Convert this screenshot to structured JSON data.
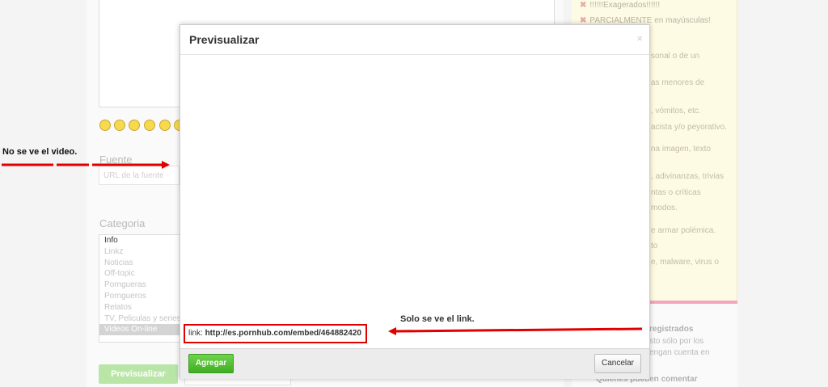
{
  "modal": {
    "title": "Previsualizar",
    "close_glyph": "×",
    "link_prefix": "link: ",
    "link_url": "http://es.pornhub.com/embed/464882420",
    "agregar_label": "Agregar",
    "cancelar_label": "Cancelar"
  },
  "form": {
    "fuente_label": "Fuente",
    "fuente_placeholder": "URL de la fuente",
    "categoria_label": "Categoria",
    "categories": [
      "Info",
      "Linkz",
      "Noticias",
      "Off-topic",
      "Porngueras",
      "Porngueros",
      "Relatos",
      "TV, Peliculas y series",
      "Videos On-line"
    ],
    "selected_category": "Videos On-line",
    "previsualizar_label": "Previsualizar"
  },
  "rules_panel": {
    "rule_1": "!!!!!!Exagerados!!!!!!",
    "rule_2": "PARCIALMENTE en mayúsculas!",
    "fragments": [
      "sonal o de un",
      "as menores de",
      ", vómitos, etc.",
      "acista y/o peyorativo.",
      "na imagen, texto",
      ", adivinanzas, trivias",
      "ntas o críticas",
      "modos.",
      "e armar polémica.",
      "to",
      "e, malware, virus o"
    ]
  },
  "lower_right": {
    "registrados": "registrados",
    "line_1": "sto sólo por los",
    "line_2": "engan cuenta en",
    "quienes_comentar": "Quiénes pueden comentar"
  },
  "annotations": {
    "left_note": "No se ve el video.",
    "right_note": "Solo se ve el link.",
    "arrow_color": "#e00000"
  },
  "colors": {
    "agregar_green": "#4cbb2c",
    "highlight_red": "#e00000"
  }
}
